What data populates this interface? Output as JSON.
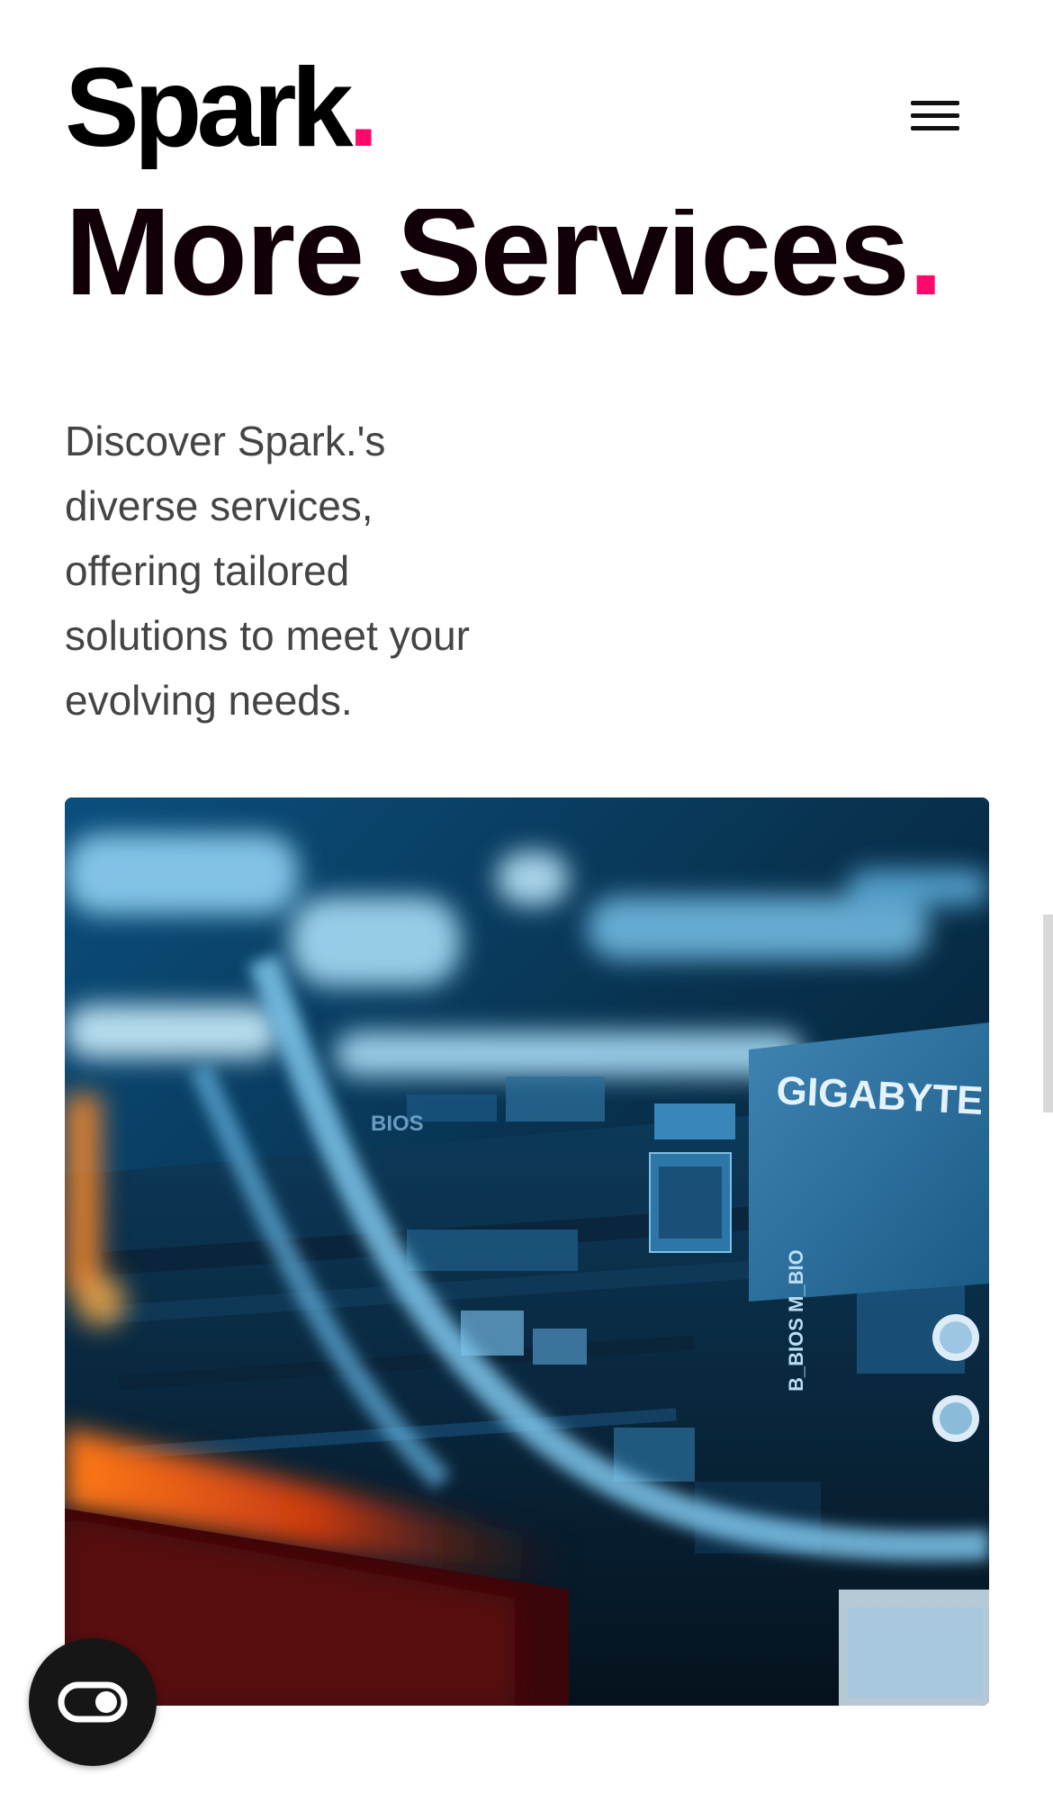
{
  "header": {
    "logo_text": "Spark",
    "logo_dot": ".",
    "menu_icon": "hamburger-menu-icon"
  },
  "hero": {
    "heading_text": "More Services",
    "heading_dot": ".",
    "description": "Discover Spark.'s diverse services, offering tailored solutions to meet your evolving needs."
  },
  "feature_image": {
    "subject": "computer-motherboard-photo",
    "chip_label": "GIGABYTE",
    "silk_label_1": "B_BIOS M_BIO",
    "silk_label_2": "BIOS"
  },
  "floating_button": {
    "icon": "accessibility-toggle-icon"
  },
  "colors": {
    "accent": "#ff0a6c",
    "heading": "#110008",
    "body_text": "#444444",
    "button_bg": "#161616"
  }
}
